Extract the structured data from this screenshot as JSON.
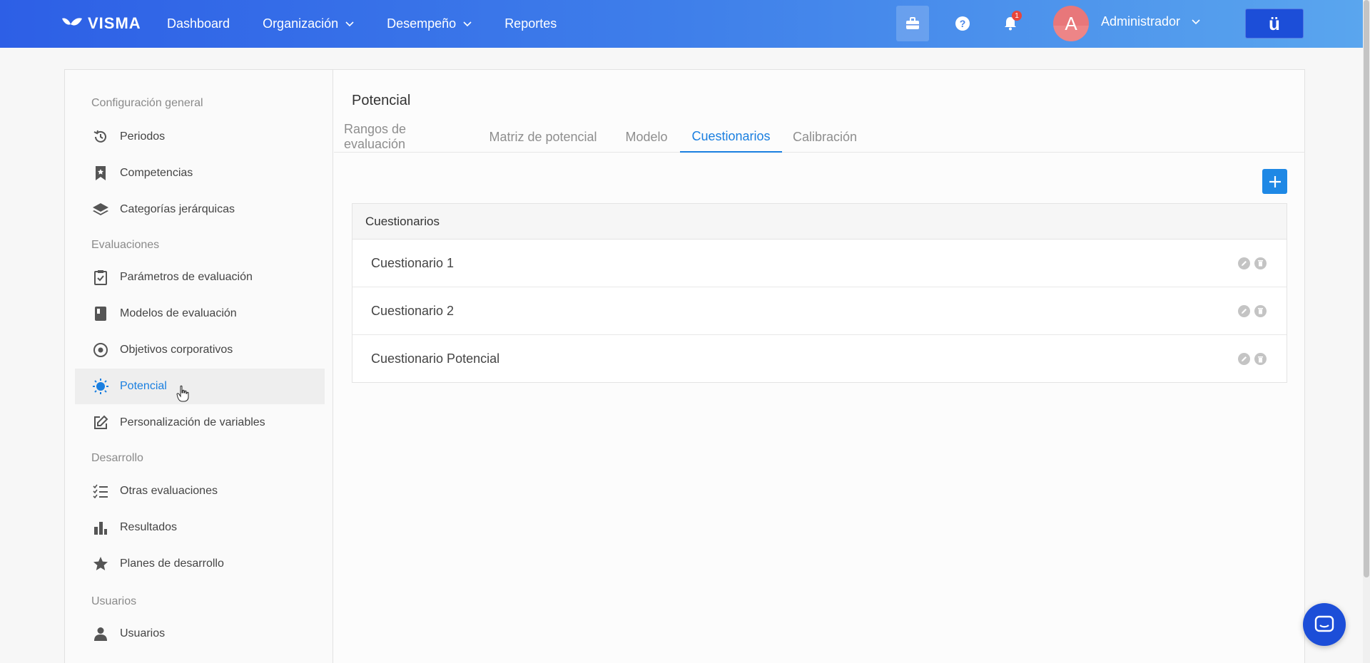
{
  "topnav": {
    "brand": "VISMA",
    "links": [
      {
        "label": "Dashboard",
        "dropdown": false
      },
      {
        "label": "Organización",
        "dropdown": true
      },
      {
        "label": "Desempeño",
        "dropdown": true
      },
      {
        "label": "Reportes",
        "dropdown": false
      }
    ],
    "notification_count": "1",
    "avatar_initial": "A",
    "user_name": "Administrador",
    "brand_button": "ü"
  },
  "sidebar": {
    "sections": [
      {
        "heading": "Configuración general",
        "items": [
          {
            "label": "Periodos",
            "icon": "history-icon"
          },
          {
            "label": "Competencias",
            "icon": "bookmark-icon"
          },
          {
            "label": "Categorías jerárquicas",
            "icon": "layers-icon"
          }
        ]
      },
      {
        "heading": "Evaluaciones",
        "items": [
          {
            "label": "Parámetros de evaluación",
            "icon": "clipboard-check-icon"
          },
          {
            "label": "Modelos de evaluación",
            "icon": "book-icon"
          },
          {
            "label": "Objetivos corporativos",
            "icon": "target-icon"
          },
          {
            "label": "Potencial",
            "icon": "lightbulb-icon",
            "active": true
          },
          {
            "label": "Personalización de variables",
            "icon": "edit-icon"
          }
        ]
      },
      {
        "heading": "Desarrollo",
        "items": [
          {
            "label": "Otras evaluaciones",
            "icon": "checklist-icon"
          },
          {
            "label": "Resultados",
            "icon": "bar-chart-icon"
          },
          {
            "label": "Planes de desarrollo",
            "icon": "star-icon"
          }
        ]
      },
      {
        "heading": "Usuarios",
        "items": [
          {
            "label": "Usuarios",
            "icon": "user-icon"
          }
        ]
      }
    ]
  },
  "content": {
    "title": "Potencial",
    "tabs": [
      {
        "label": "Rangos de evaluación"
      },
      {
        "label": "Matriz de potencial"
      },
      {
        "label": "Modelo"
      },
      {
        "label": "Cuestionarios",
        "active": true
      },
      {
        "label": "Calibración"
      }
    ],
    "add_button": "+",
    "table": {
      "header": "Cuestionarios",
      "rows": [
        "Cuestionario 1",
        "Cuestionario 2",
        "Cuestionario Potencial"
      ]
    }
  },
  "colors": {
    "accent": "#1a7fe0",
    "nav_start": "#2d5fe6",
    "nav_end": "#5aa6ee",
    "brand_button": "#1c4ed8"
  }
}
